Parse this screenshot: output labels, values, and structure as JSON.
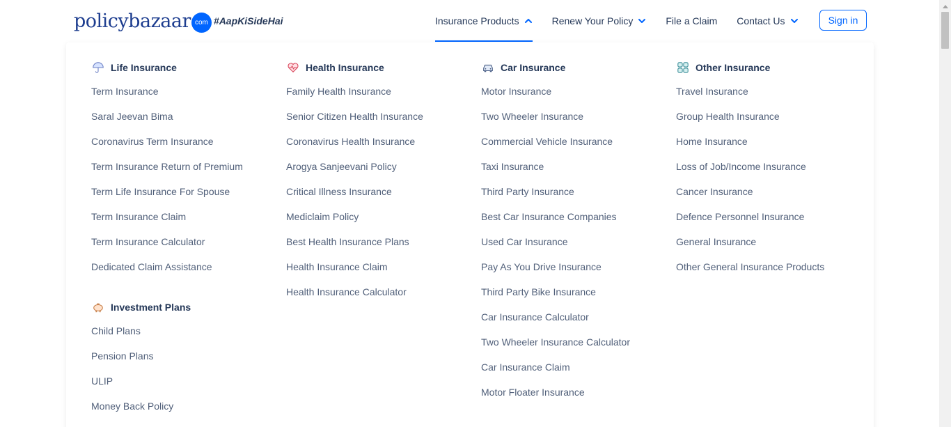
{
  "brand": {
    "name": "policybazaar",
    "suffix": "com",
    "tagline": "#AapKiSideHai"
  },
  "nav": {
    "items": [
      {
        "label": "Insurance Products",
        "has_chevron": true,
        "chevron": "chevron-up",
        "active": true
      },
      {
        "label": "Renew Your Policy",
        "has_chevron": true,
        "chevron": "chevron-down",
        "active": false
      },
      {
        "label": "File a Claim",
        "has_chevron": false,
        "active": false
      },
      {
        "label": "Contact Us",
        "has_chevron": true,
        "chevron": "chevron-down",
        "active": false
      }
    ],
    "signin_label": "Sign in"
  },
  "colors": {
    "accent": "#0065ff",
    "heading": "#253858",
    "link": "#505f79"
  },
  "menu": {
    "life": {
      "title": "Life Insurance",
      "icon": "umbrella-icon",
      "links": [
        "Term Insurance",
        "Saral Jeevan Bima",
        "Coronavirus Term Insurance",
        "Term Insurance Return of Premium",
        "Term Life Insurance For Spouse",
        "Term Insurance Claim",
        "Term Insurance Calculator",
        "Dedicated Claim Assistance"
      ]
    },
    "investment": {
      "title": "Investment Plans",
      "icon": "piggy-bank-icon",
      "links": [
        "Child Plans",
        "Pension Plans",
        "ULIP",
        "Money Back Policy"
      ]
    },
    "health": {
      "title": "Health Insurance",
      "icon": "heart-pulse-icon",
      "links": [
        "Family Health Insurance",
        "Senior Citizen Health Insurance",
        "Coronavirus Health Insurance",
        "Arogya Sanjeevani Policy",
        "Critical Illness Insurance",
        "Mediclaim Policy",
        "Best Health Insurance Plans",
        "Health Insurance Claim",
        "Health Insurance Calculator"
      ]
    },
    "car": {
      "title": "Car Insurance",
      "icon": "car-icon",
      "links": [
        "Motor Insurance",
        "Two Wheeler Insurance",
        "Commercial Vehicle Insurance",
        "Taxi Insurance",
        "Third Party Insurance",
        "Best Car Insurance Companies",
        "Used Car Insurance",
        "Pay As You Drive Insurance",
        "Third Party Bike Insurance",
        "Car Insurance Calculator",
        "Two Wheeler Insurance Calculator",
        "Car Insurance Claim",
        "Motor Floater Insurance"
      ]
    },
    "other": {
      "title": "Other Insurance",
      "icon": "grid-icon",
      "links": [
        "Travel Insurance",
        "Group Health Insurance",
        "Home Insurance",
        "Loss of Job/Income Insurance",
        "Cancer Insurance",
        "Defence Personnel Insurance",
        "General Insurance",
        "Other General Insurance Products"
      ]
    }
  }
}
